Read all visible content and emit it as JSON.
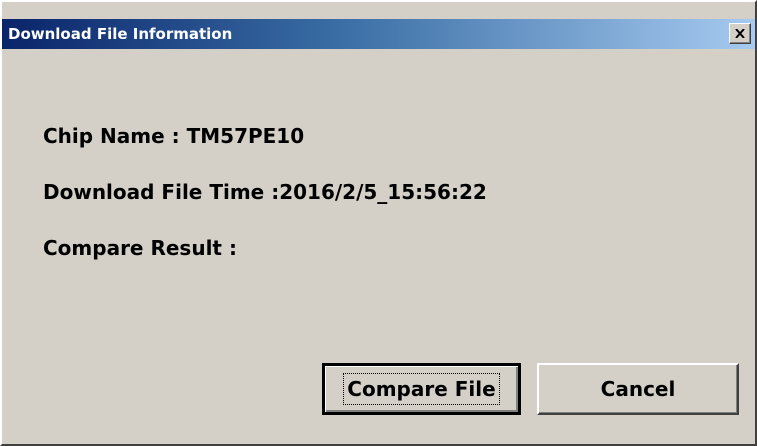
{
  "window": {
    "title": "Download File Information",
    "close_icon": "close-x-icon"
  },
  "info": {
    "chip_name": "Chip Name : TM57PE10",
    "download_time": "Download File Time :2016/2/5_15:56:22",
    "compare_result": "Compare Result :"
  },
  "buttons": {
    "compare_file": "Compare File",
    "cancel": "Cancel"
  },
  "colors": {
    "dialog_face": "#d4d0c8",
    "titlebar_start": "#0a246a",
    "titlebar_end": "#a6caf0"
  }
}
